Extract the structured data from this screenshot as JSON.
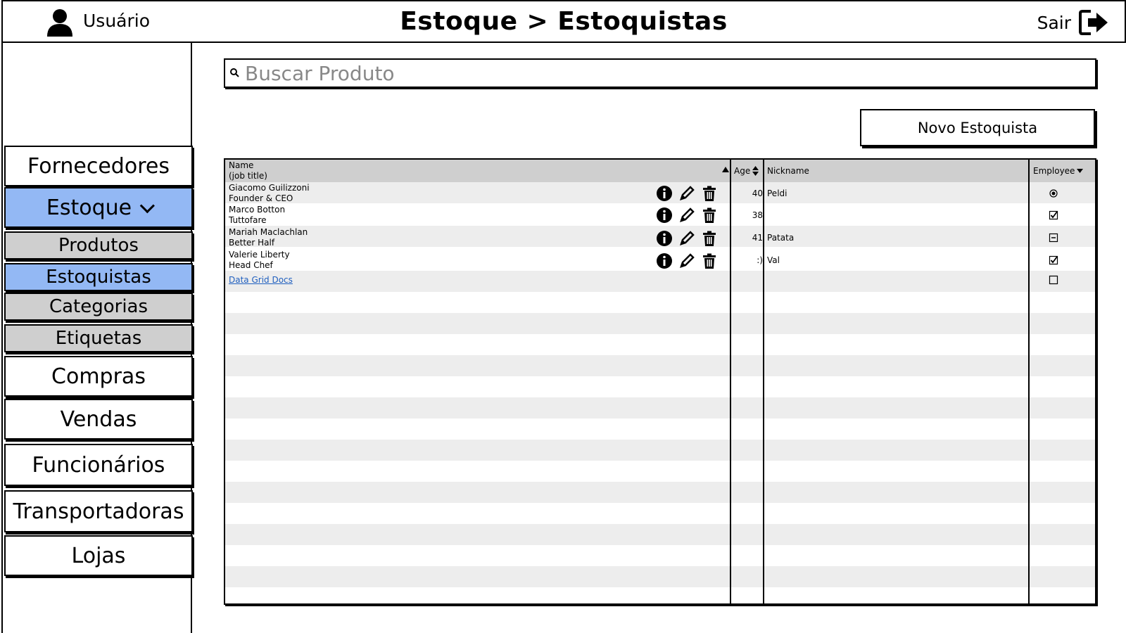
{
  "header": {
    "user_label": "Usuário",
    "title": "Estoque > Estoquistas",
    "logout_label": "Sair"
  },
  "sidebar": {
    "items": [
      {
        "label": "Fornecedores"
      },
      {
        "label": "Estoque",
        "expanded": true,
        "active": true
      },
      {
        "label": "Produtos"
      },
      {
        "label": "Estoquistas",
        "active": true
      },
      {
        "label": "Categorias"
      },
      {
        "label": "Etiquetas"
      },
      {
        "label": "Compras"
      },
      {
        "label": "Vendas"
      },
      {
        "label": "Funcionários"
      },
      {
        "label": "Transportadoras"
      },
      {
        "label": "Lojas"
      }
    ]
  },
  "search": {
    "placeholder": "Buscar Produto",
    "value": ""
  },
  "actions": {
    "new_label": "Novo Estoquista"
  },
  "grid": {
    "headers": {
      "name": "Name",
      "name_sub": "(job title)",
      "age": "Age",
      "nickname": "Nickname",
      "employee": "Employee"
    },
    "rows": [
      {
        "name": "Giacomo Guilizzoni",
        "title": "Founder & CEO",
        "age": "40",
        "nickname": "Peldi",
        "employee": "radio"
      },
      {
        "name": "Marco Botton",
        "title": "Tuttofare",
        "age": "38",
        "nickname": "",
        "employee": "checked"
      },
      {
        "name": "Mariah Maclachlan",
        "title": "Better Half",
        "age": "41",
        "nickname": "Patata",
        "employee": "indeterminate"
      },
      {
        "name": "Valerie Liberty",
        "title": "Head Chef",
        "age": ":)",
        "nickname": "Val",
        "employee": "checked"
      }
    ],
    "docs_link": "Data Grid Docs",
    "docs_employee": "unchecked"
  },
  "colors": {
    "active": "#93b8f4",
    "submenu": "#cfcfcf",
    "header_row": "#cfcfcf",
    "stripe": "#ededed",
    "link": "#1f5fbf"
  }
}
